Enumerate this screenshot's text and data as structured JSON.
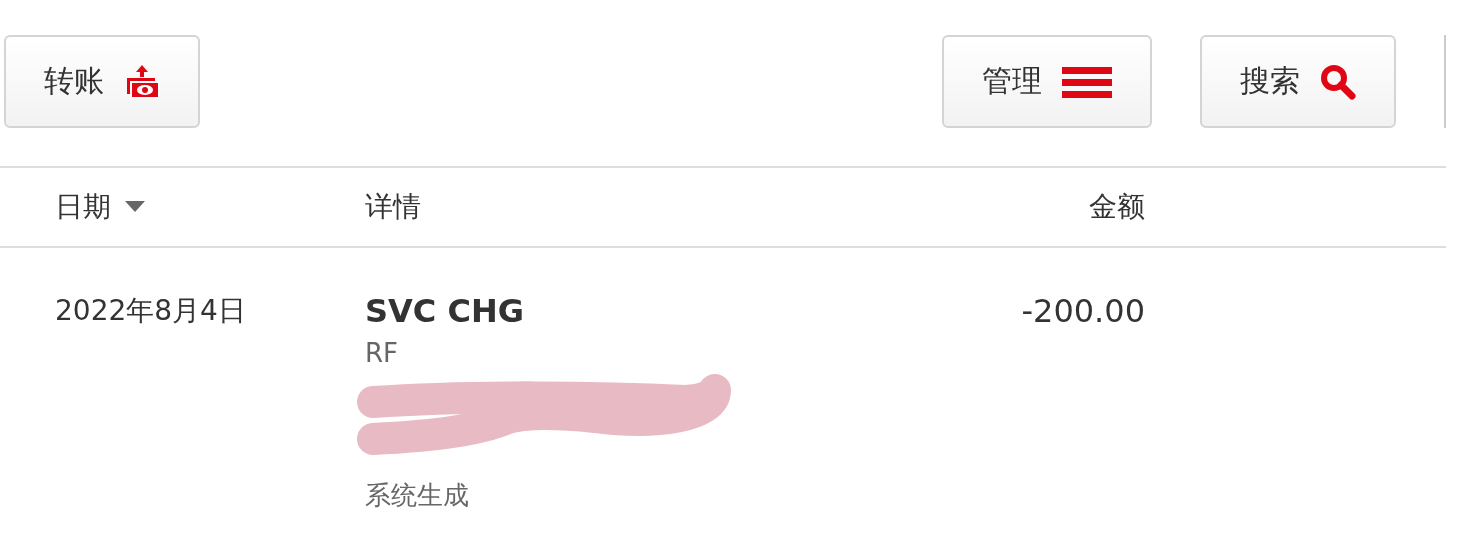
{
  "toolbar": {
    "left": [
      {
        "label": "转账",
        "kind": "transfer"
      }
    ],
    "right": [
      {
        "label": "管理",
        "kind": "manage"
      },
      {
        "label": "搜索",
        "kind": "search"
      }
    ]
  },
  "table": {
    "columns": [
      {
        "label": "日期",
        "sorted": true
      },
      {
        "label": "详情",
        "sorted": false
      },
      {
        "label": "金额",
        "sorted": false
      }
    ],
    "rows": [
      {
        "date": "2022年8月4日",
        "title": "SVC CHG",
        "ref": "RF",
        "redacted": true,
        "note": "系统生成",
        "amount": "-200.00"
      }
    ]
  }
}
